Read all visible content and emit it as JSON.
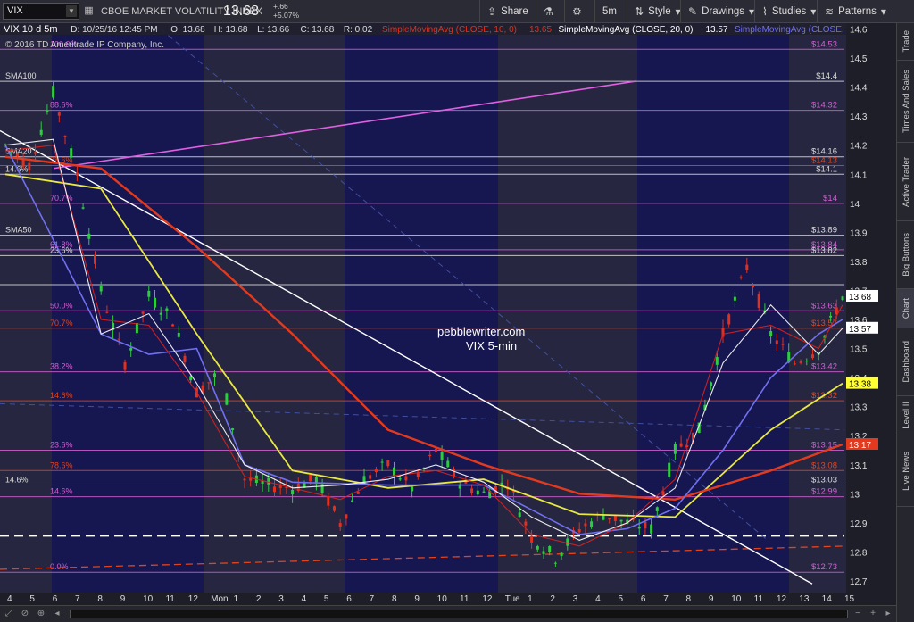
{
  "toolbar": {
    "symbol": "VIX",
    "description": "CBOE MARKET VOLATILITY INDEX",
    "last": "13.68",
    "change": "+.66",
    "change_pct": "+5.07%",
    "share_label": "Share",
    "timeframe": "5m",
    "style_label": "Style",
    "drawings_label": "Drawings",
    "studies_label": "Studies",
    "patterns_label": "Patterns"
  },
  "sidebar": {
    "tabs": [
      "Trade",
      "Times And Sales",
      "Active Trader",
      "Big Buttons",
      "Chart",
      "Dashboard",
      "Level II",
      "Live News"
    ],
    "active": "Chart"
  },
  "chart": {
    "header": {
      "title": "VIX 10 d 5m",
      "date_label": "D: 10/25/16 12:45 PM",
      "open": "O: 13.68",
      "high": "H: 13.68",
      "low": "L: 13.66",
      "close": "C: 13.68",
      "range": "R: 0.02",
      "sma10": "SimpleMovingAvg (CLOSE, 10, 0)",
      "sma10_val": "13.65",
      "sma20": "SimpleMovingAvg (CLOSE, 20, 0)",
      "sma20_val": "13.57",
      "sma_blue": "SimpleMovingAvg (CLOSE,"
    },
    "copyright": "© 2016 TD Ameritrade IP Company, Inc.",
    "watermark": "pebblewriter.com",
    "watermark2": "VIX 5-min",
    "y_ticks": [
      "14.6",
      "14.5",
      "14.4",
      "14.3",
      "14.2",
      "14.1",
      "14",
      "13.9",
      "13.8",
      "13.7",
      "13.6",
      "13.5",
      "13.4",
      "13.3",
      "13.2",
      "13.1",
      "13",
      "12.9",
      "12.8",
      "12.7"
    ],
    "x_ticks": [
      "4",
      "5",
      "6",
      "7",
      "8",
      "9",
      "10",
      "11",
      "12",
      "Mon",
      "1",
      "2",
      "3",
      "4",
      "5",
      "6",
      "7",
      "8",
      "9",
      "10",
      "11",
      "12",
      "Tue",
      "1",
      "2",
      "3",
      "4",
      "5",
      "6",
      "7",
      "8",
      "9",
      "10",
      "11",
      "12",
      "13",
      "14",
      "15"
    ],
    "price_tags": [
      {
        "text": "13.68",
        "bg": "#ffffff",
        "fg": "#000000"
      },
      {
        "text": "13.57",
        "bg": "#ffffff",
        "fg": "#000000"
      },
      {
        "text": "13.38",
        "bg": "#ffff33",
        "fg": "#000000"
      },
      {
        "text": "13.17",
        "bg": "#e23a1e",
        "fg": "#ffffff"
      }
    ],
    "levels": [
      {
        "left": "100.0%",
        "right": "$14.53",
        "value": 14.53,
        "color": "#d060d0"
      },
      {
        "left": "SMA100",
        "right": "$14.4",
        "value": 14.42,
        "color": "#dddddd"
      },
      {
        "left": "88.6%",
        "right": "$14.32",
        "value": 14.32,
        "color": "#d060d0"
      },
      {
        "left": "SMA20",
        "right": "$14.16",
        "value": 14.16,
        "color": "#dddddd"
      },
      {
        "left": "78.6%",
        "right": "$14.13",
        "value": 14.13,
        "color": "#e2451e"
      },
      {
        "left": "14.6%",
        "right": "$14.1",
        "value": 14.1,
        "color": "#dddddd"
      },
      {
        "left": "70.7%",
        "right": "$14",
        "value": 14.0,
        "color": "#d060d0"
      },
      {
        "left": "SMA50",
        "right": "$13.89",
        "value": 13.89,
        "color": "#dddddd"
      },
      {
        "left": "61.8%",
        "right": "$13.84",
        "value": 13.84,
        "color": "#d060d0"
      },
      {
        "left": "23.6%",
        "right": "$13.82",
        "value": 13.82,
        "color": "#dddddd"
      },
      {
        "left": "",
        "right": "",
        "value": 13.72,
        "color": "#dddddd"
      },
      {
        "left": "50.0%",
        "right": "$13.63",
        "value": 13.63,
        "color": "#d060d0"
      },
      {
        "left": "70.7%",
        "right": "$13.57",
        "value": 13.57,
        "color": "#e2451e"
      },
      {
        "left": "38.2%",
        "right": "$13.42",
        "value": 13.42,
        "color": "#d060d0"
      },
      {
        "left": "14.6%",
        "right": "$13.32",
        "value": 13.32,
        "color": "#e2451e"
      },
      {
        "left": "23.6%",
        "right": "$13.15",
        "value": 13.15,
        "color": "#d060d0"
      },
      {
        "left": "78.6%",
        "right": "$13.08",
        "value": 13.08,
        "color": "#e2451e"
      },
      {
        "left": "14.6%",
        "right": "$13.03",
        "value": 13.03,
        "color": "#dddddd"
      },
      {
        "left": "14.6%",
        "right": "$12.99",
        "value": 12.99,
        "color": "#d060d0"
      },
      {
        "left": "0.0%",
        "right": "$12.73",
        "value": 12.73,
        "color": "#d060d0"
      }
    ]
  },
  "chart_data": {
    "type": "line",
    "title": "VIX 10 d 5m",
    "xlabel": "",
    "ylabel": "",
    "ylim": [
      12.66,
      14.62
    ],
    "series": [
      {
        "name": "VIX",
        "color": "#ffffff",
        "x": [
          0,
          1,
          2,
          3,
          4,
          5,
          6,
          7,
          8,
          9,
          10,
          11,
          12,
          13,
          14,
          15,
          16,
          17,
          18,
          19,
          20,
          21,
          22,
          23,
          24,
          25,
          26,
          27,
          28,
          29,
          30,
          31,
          32,
          33,
          34,
          35
        ],
        "values": [
          14.2,
          14.13,
          14.38,
          14.1,
          13.7,
          13.45,
          13.68,
          13.6,
          13.35,
          13.42,
          13.05,
          13.03,
          13.02,
          13.05,
          12.9,
          13.05,
          13.1,
          13.02,
          13.15,
          13.04,
          13.0,
          13.04,
          12.85,
          12.78,
          12.88,
          12.93,
          12.9,
          12.88,
          13.15,
          13.22,
          13.55,
          13.78,
          13.55,
          13.45,
          13.5,
          13.68
        ]
      },
      {
        "name": "SimpleMovingAvg (CLOSE, 10, 0)",
        "color": "#e0201c",
        "x": [
          0,
          2,
          4,
          6,
          8,
          10,
          12,
          14,
          16,
          18,
          20,
          22,
          24,
          26,
          28,
          30,
          32,
          34,
          35
        ],
        "values": [
          14.18,
          14.2,
          13.6,
          13.58,
          13.35,
          13.06,
          13.02,
          12.98,
          13.06,
          13.08,
          13.03,
          12.86,
          12.82,
          12.9,
          13.05,
          13.55,
          13.58,
          13.5,
          13.65
        ]
      },
      {
        "name": "SimpleMovingAvg (CLOSE, 20, 0)",
        "color": "#ffffff",
        "x": [
          0,
          2,
          4,
          6,
          8,
          10,
          12,
          14,
          16,
          18,
          20,
          22,
          24,
          26,
          28,
          30,
          32,
          34,
          35
        ],
        "values": [
          14.2,
          14.22,
          13.55,
          13.62,
          13.38,
          13.1,
          13.02,
          13.03,
          13.05,
          13.1,
          13.04,
          12.92,
          12.84,
          12.9,
          13.02,
          13.45,
          13.65,
          13.48,
          13.57
        ]
      }
    ]
  }
}
